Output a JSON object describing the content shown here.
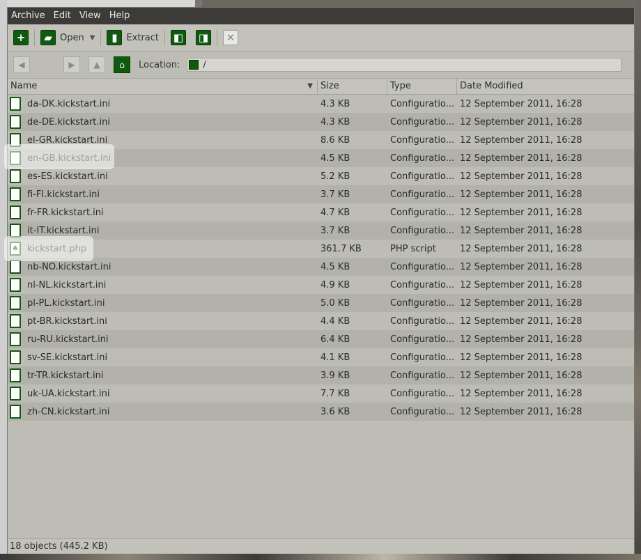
{
  "menu": [
    "Archive",
    "Edit",
    "View",
    "Help"
  ],
  "toolbar": {
    "open_label": "Open",
    "extract_label": "Extract"
  },
  "location": {
    "label": "Location:",
    "value": "/"
  },
  "columns": {
    "name": "Name",
    "size": "Size",
    "type": "Type",
    "date": "Date Modified"
  },
  "files": [
    {
      "name": "da-DK.kickstart.ini",
      "size": "4.3 KB",
      "type": "Configuratio...",
      "date": "12 September 2011, 16:28",
      "icon": "document-icon"
    },
    {
      "name": "de-DE.kickstart.ini",
      "size": "4.3 KB",
      "type": "Configuratio...",
      "date": "12 September 2011, 16:28",
      "icon": "document-icon"
    },
    {
      "name": "el-GR.kickstart.ini",
      "size": "8.6 KB",
      "type": "Configuratio...",
      "date": "12 September 2011, 16:28",
      "icon": "document-icon"
    },
    {
      "name": "en-GB.kickstart.ini",
      "size": "4.5 KB",
      "type": "Configuratio...",
      "date": "12 September 2011, 16:28",
      "icon": "document-icon"
    },
    {
      "name": "es-ES.kickstart.ini",
      "size": "5.2 KB",
      "type": "Configuratio...",
      "date": "12 September 2011, 16:28",
      "icon": "document-icon"
    },
    {
      "name": "fi-FI.kickstart.ini",
      "size": "3.7 KB",
      "type": "Configuratio...",
      "date": "12 September 2011, 16:28",
      "icon": "document-icon"
    },
    {
      "name": "fr-FR.kickstart.ini",
      "size": "4.7 KB",
      "type": "Configuratio...",
      "date": "12 September 2011, 16:28",
      "icon": "document-icon"
    },
    {
      "name": "it-IT.kickstart.ini",
      "size": "3.7 KB",
      "type": "Configuratio...",
      "date": "12 September 2011, 16:28",
      "icon": "document-icon"
    },
    {
      "name": "kickstart.php",
      "size": "361.7 KB",
      "type": "PHP script",
      "date": "12 September 2011, 16:28",
      "icon": "php-script-icon"
    },
    {
      "name": "nb-NO.kickstart.ini",
      "size": "4.5 KB",
      "type": "Configuratio...",
      "date": "12 September 2011, 16:28",
      "icon": "document-icon"
    },
    {
      "name": "nl-NL.kickstart.ini",
      "size": "4.9 KB",
      "type": "Configuratio...",
      "date": "12 September 2011, 16:28",
      "icon": "document-icon"
    },
    {
      "name": "pl-PL.kickstart.ini",
      "size": "5.0 KB",
      "type": "Configuratio...",
      "date": "12 September 2011, 16:28",
      "icon": "document-icon"
    },
    {
      "name": "pt-BR.kickstart.ini",
      "size": "4.4 KB",
      "type": "Configuratio...",
      "date": "12 September 2011, 16:28",
      "icon": "document-icon"
    },
    {
      "name": "ru-RU.kickstart.ini",
      "size": "6.4 KB",
      "type": "Configuratio...",
      "date": "12 September 2011, 16:28",
      "icon": "document-icon"
    },
    {
      "name": "sv-SE.kickstart.ini",
      "size": "4.1 KB",
      "type": "Configuratio...",
      "date": "12 September 2011, 16:28",
      "icon": "document-icon"
    },
    {
      "name": "tr-TR.kickstart.ini",
      "size": "3.9 KB",
      "type": "Configuratio...",
      "date": "12 September 2011, 16:28",
      "icon": "document-icon"
    },
    {
      "name": "uk-UA.kickstart.ini",
      "size": "7.7 KB",
      "type": "Configuratio...",
      "date": "12 September 2011, 16:28",
      "icon": "document-icon"
    },
    {
      "name": "zh-CN.kickstart.ini",
      "size": "3.6 KB",
      "type": "Configuratio...",
      "date": "12 September 2011, 16:28",
      "icon": "document-icon"
    }
  ],
  "status": "18 objects (445.2 KB)",
  "colors": {
    "accent": "#0f5a0f",
    "menubar": "#3c3b37",
    "window": "#bdbdb5"
  }
}
